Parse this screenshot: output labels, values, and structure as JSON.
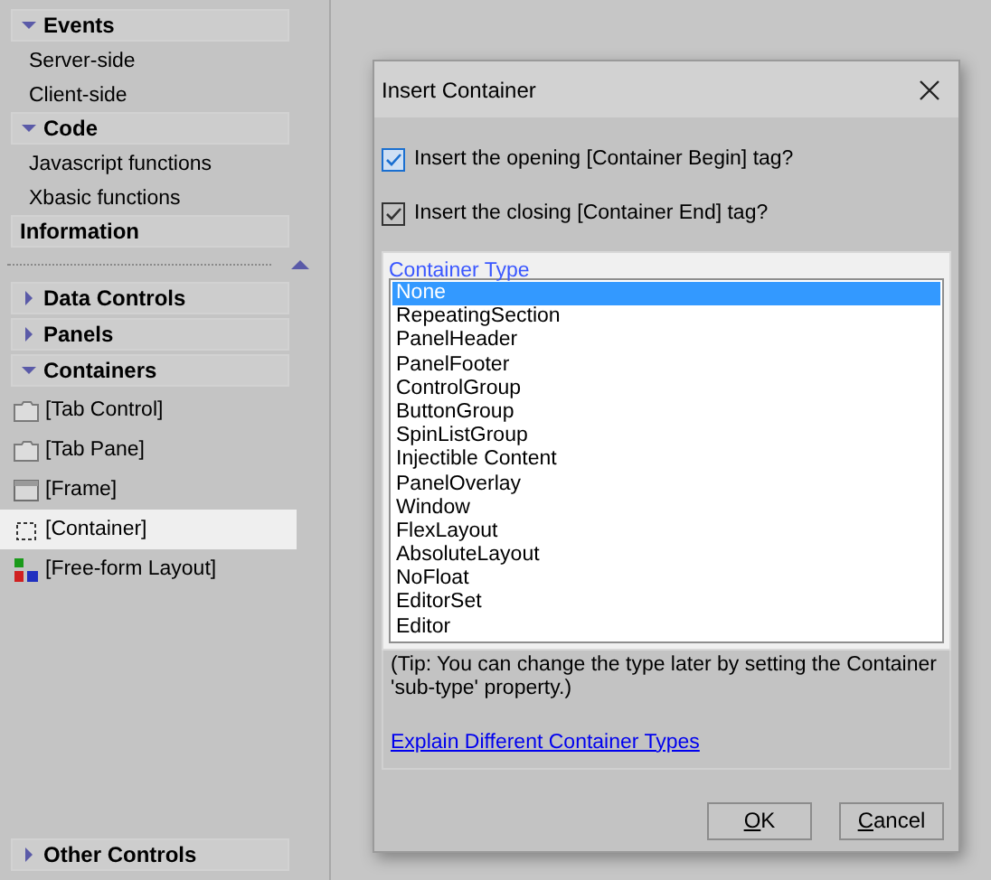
{
  "sidebar": {
    "top_sections": [
      {
        "title": "Events",
        "kind": "expandable",
        "expanded": true,
        "items": [
          {
            "label": "Server-side",
            "selected": false
          },
          {
            "label": "Client-side",
            "selected": false
          }
        ]
      },
      {
        "title": "Code",
        "kind": "expandable",
        "expanded": true,
        "items": [
          {
            "label": "Javascript functions",
            "selected": false
          },
          {
            "label": "Xbasic functions",
            "selected": false
          }
        ]
      },
      {
        "title": "Information",
        "kind": "plain"
      }
    ],
    "sections": [
      {
        "title": "Data Controls",
        "kind": "expandable",
        "expanded": false
      },
      {
        "title": "Panels",
        "kind": "expandable",
        "expanded": false
      },
      {
        "title": "Containers",
        "kind": "expandable",
        "expanded": true,
        "items": [
          {
            "label": "[Tab Control]",
            "kind": "folder",
            "selected": false
          },
          {
            "label": "[Tab Pane]",
            "kind": "folder",
            "selected": false
          },
          {
            "label": "[Frame]",
            "kind": "frame",
            "selected": false
          },
          {
            "label": "[Container]",
            "kind": "dashed",
            "selected": true
          },
          {
            "label": "[Free-form Layout]",
            "kind": "layout",
            "selected": false
          }
        ]
      }
    ],
    "bottom_sections": [
      {
        "title": "Other Controls",
        "kind": "expandable",
        "expanded": false
      }
    ]
  },
  "dialog": {
    "title": "Insert Container",
    "checkboxes": [
      {
        "label": "Insert the opening [Container Begin] tag?",
        "checked": true,
        "focused": true
      },
      {
        "label": "Insert the closing [Container End] tag?",
        "checked": true,
        "focused": false
      }
    ],
    "group": {
      "legend": "Container Type",
      "options": [
        {
          "label": "None",
          "selected": true
        },
        {
          "label": "RepeatingSection",
          "selected": false
        },
        {
          "label": "PanelHeader",
          "selected": false
        },
        {
          "label": "PanelFooter",
          "selected": false
        },
        {
          "label": "ControlGroup",
          "selected": false
        },
        {
          "label": "ButtonGroup",
          "selected": false
        },
        {
          "label": "SpinListGroup",
          "selected": false
        },
        {
          "label": "Injectible Content",
          "selected": false
        },
        {
          "label": "PanelOverlay",
          "selected": false
        },
        {
          "label": "Window",
          "selected": false
        },
        {
          "label": "FlexLayout",
          "selected": false
        },
        {
          "label": "AbsoluteLayout",
          "selected": false
        },
        {
          "label": "NoFloat",
          "selected": false
        },
        {
          "label": "EditorSet",
          "selected": false
        },
        {
          "label": "Editor",
          "selected": false
        }
      ],
      "tip": "(Tip: You can change the type later  by setting the Container 'sub-type' property.)",
      "link": "Explain Different Container Types"
    },
    "buttons": [
      "OK",
      "Cancel"
    ]
  }
}
